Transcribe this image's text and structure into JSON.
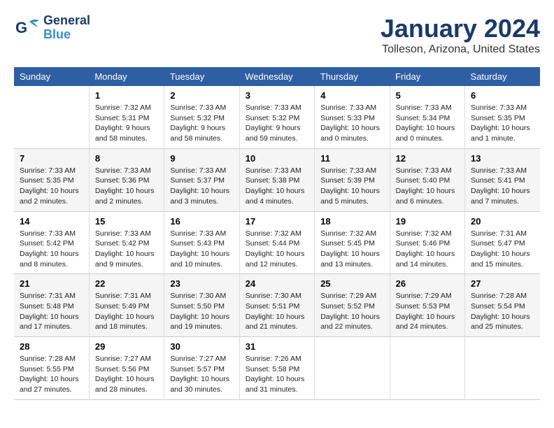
{
  "header": {
    "logo_general": "General",
    "logo_blue": "Blue",
    "title": "January 2024",
    "subtitle": "Tolleson, Arizona, United States"
  },
  "weekdays": [
    "Sunday",
    "Monday",
    "Tuesday",
    "Wednesday",
    "Thursday",
    "Friday",
    "Saturday"
  ],
  "weeks": [
    [
      {
        "num": "",
        "info": ""
      },
      {
        "num": "1",
        "info": "Sunrise: 7:32 AM\nSunset: 5:31 PM\nDaylight: 9 hours\nand 58 minutes."
      },
      {
        "num": "2",
        "info": "Sunrise: 7:33 AM\nSunset: 5:32 PM\nDaylight: 9 hours\nand 58 minutes."
      },
      {
        "num": "3",
        "info": "Sunrise: 7:33 AM\nSunset: 5:32 PM\nDaylight: 9 hours\nand 59 minutes."
      },
      {
        "num": "4",
        "info": "Sunrise: 7:33 AM\nSunset: 5:33 PM\nDaylight: 10 hours\nand 0 minutes."
      },
      {
        "num": "5",
        "info": "Sunrise: 7:33 AM\nSunset: 5:34 PM\nDaylight: 10 hours\nand 0 minutes."
      },
      {
        "num": "6",
        "info": "Sunrise: 7:33 AM\nSunset: 5:35 PM\nDaylight: 10 hours\nand 1 minute."
      }
    ],
    [
      {
        "num": "7",
        "info": "Sunrise: 7:33 AM\nSunset: 5:35 PM\nDaylight: 10 hours\nand 2 minutes."
      },
      {
        "num": "8",
        "info": "Sunrise: 7:33 AM\nSunset: 5:36 PM\nDaylight: 10 hours\nand 2 minutes."
      },
      {
        "num": "9",
        "info": "Sunrise: 7:33 AM\nSunset: 5:37 PM\nDaylight: 10 hours\nand 3 minutes."
      },
      {
        "num": "10",
        "info": "Sunrise: 7:33 AM\nSunset: 5:38 PM\nDaylight: 10 hours\nand 4 minutes."
      },
      {
        "num": "11",
        "info": "Sunrise: 7:33 AM\nSunset: 5:39 PM\nDaylight: 10 hours\nand 5 minutes."
      },
      {
        "num": "12",
        "info": "Sunrise: 7:33 AM\nSunset: 5:40 PM\nDaylight: 10 hours\nand 6 minutes."
      },
      {
        "num": "13",
        "info": "Sunrise: 7:33 AM\nSunset: 5:41 PM\nDaylight: 10 hours\nand 7 minutes."
      }
    ],
    [
      {
        "num": "14",
        "info": "Sunrise: 7:33 AM\nSunset: 5:42 PM\nDaylight: 10 hours\nand 8 minutes."
      },
      {
        "num": "15",
        "info": "Sunrise: 7:33 AM\nSunset: 5:42 PM\nDaylight: 10 hours\nand 9 minutes."
      },
      {
        "num": "16",
        "info": "Sunrise: 7:33 AM\nSunset: 5:43 PM\nDaylight: 10 hours\nand 10 minutes."
      },
      {
        "num": "17",
        "info": "Sunrise: 7:32 AM\nSunset: 5:44 PM\nDaylight: 10 hours\nand 12 minutes."
      },
      {
        "num": "18",
        "info": "Sunrise: 7:32 AM\nSunset: 5:45 PM\nDaylight: 10 hours\nand 13 minutes."
      },
      {
        "num": "19",
        "info": "Sunrise: 7:32 AM\nSunset: 5:46 PM\nDaylight: 10 hours\nand 14 minutes."
      },
      {
        "num": "20",
        "info": "Sunrise: 7:31 AM\nSunset: 5:47 PM\nDaylight: 10 hours\nand 15 minutes."
      }
    ],
    [
      {
        "num": "21",
        "info": "Sunrise: 7:31 AM\nSunset: 5:48 PM\nDaylight: 10 hours\nand 17 minutes."
      },
      {
        "num": "22",
        "info": "Sunrise: 7:31 AM\nSunset: 5:49 PM\nDaylight: 10 hours\nand 18 minutes."
      },
      {
        "num": "23",
        "info": "Sunrise: 7:30 AM\nSunset: 5:50 PM\nDaylight: 10 hours\nand 19 minutes."
      },
      {
        "num": "24",
        "info": "Sunrise: 7:30 AM\nSunset: 5:51 PM\nDaylight: 10 hours\nand 21 minutes."
      },
      {
        "num": "25",
        "info": "Sunrise: 7:29 AM\nSunset: 5:52 PM\nDaylight: 10 hours\nand 22 minutes."
      },
      {
        "num": "26",
        "info": "Sunrise: 7:29 AM\nSunset: 5:53 PM\nDaylight: 10 hours\nand 24 minutes."
      },
      {
        "num": "27",
        "info": "Sunrise: 7:28 AM\nSunset: 5:54 PM\nDaylight: 10 hours\nand 25 minutes."
      }
    ],
    [
      {
        "num": "28",
        "info": "Sunrise: 7:28 AM\nSunset: 5:55 PM\nDaylight: 10 hours\nand 27 minutes."
      },
      {
        "num": "29",
        "info": "Sunrise: 7:27 AM\nSunset: 5:56 PM\nDaylight: 10 hours\nand 28 minutes."
      },
      {
        "num": "30",
        "info": "Sunrise: 7:27 AM\nSunset: 5:57 PM\nDaylight: 10 hours\nand 30 minutes."
      },
      {
        "num": "31",
        "info": "Sunrise: 7:26 AM\nSunset: 5:58 PM\nDaylight: 10 hours\nand 31 minutes."
      },
      {
        "num": "",
        "info": ""
      },
      {
        "num": "",
        "info": ""
      },
      {
        "num": "",
        "info": ""
      }
    ]
  ]
}
